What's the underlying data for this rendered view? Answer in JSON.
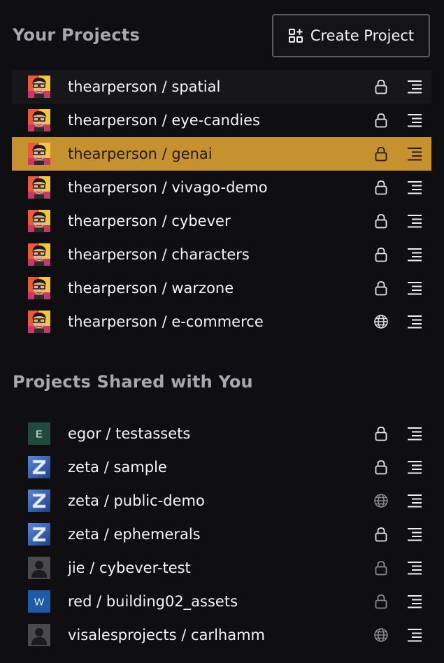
{
  "header": {
    "your_projects_title": "Your Projects",
    "create_label": "Create Project",
    "create_icon": "grid-plus-icon"
  },
  "shared": {
    "title": "Projects Shared with You"
  },
  "colors": {
    "selected_row": "#c5922f",
    "dim_text": "#a7a7ad"
  },
  "your_projects": [
    {
      "name": "thearperson / spatial",
      "visibility": "private",
      "avatar": "photo"
    },
    {
      "name": "thearperson / eye-candies",
      "visibility": "private",
      "avatar": "photo"
    },
    {
      "name": "thearperson / genai",
      "visibility": "private",
      "avatar": "photo",
      "selected": true
    },
    {
      "name": "thearperson / vivago-demo",
      "visibility": "private",
      "avatar": "photo"
    },
    {
      "name": "thearperson / cybever",
      "visibility": "private",
      "avatar": "photo"
    },
    {
      "name": "thearperson / characters",
      "visibility": "private",
      "avatar": "photo"
    },
    {
      "name": "thearperson / warzone",
      "visibility": "private",
      "avatar": "photo"
    },
    {
      "name": "thearperson / e-commerce",
      "visibility": "public",
      "avatar": "photo"
    }
  ],
  "shared_projects": [
    {
      "name": "egor / testassets",
      "visibility": "private",
      "avatar": "letter",
      "letter": "E",
      "avatar_color": "#1f4a3c"
    },
    {
      "name": "zeta / sample",
      "visibility": "private",
      "avatar": "zeta"
    },
    {
      "name": "zeta / public-demo",
      "visibility": "public",
      "avatar": "zeta",
      "dim_icon": true
    },
    {
      "name": "zeta / ephemerals",
      "visibility": "private",
      "avatar": "zeta"
    },
    {
      "name": "jie / cybever-test",
      "visibility": "private",
      "avatar": "person",
      "dim_icon": true
    },
    {
      "name": "red / building02_assets",
      "visibility": "private",
      "avatar": "letter",
      "letter": "W",
      "avatar_color": "#1f5aa8",
      "dim_icon": true
    },
    {
      "name": "visalesprojects / carlhamm",
      "visibility": "public",
      "avatar": "person",
      "dim_icon": true
    }
  ]
}
